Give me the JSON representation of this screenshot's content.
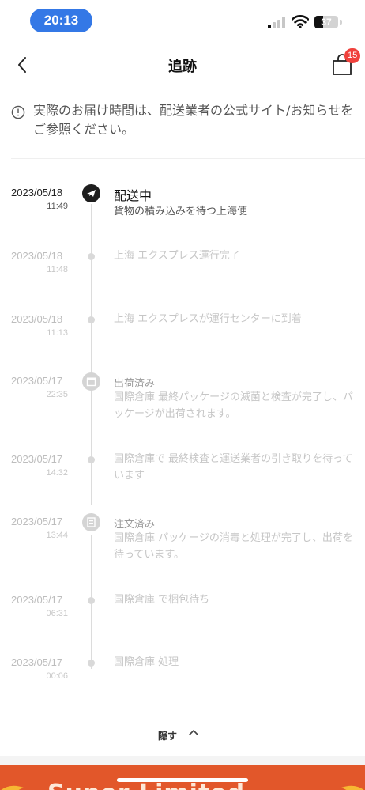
{
  "status_bar": {
    "time": "20:13",
    "battery": "37",
    "battery_level": 0.37
  },
  "header": {
    "title": "追跡",
    "bag_count": "15",
    "back_icon": "chevron-left-icon",
    "bag_icon": "shopping-bag-icon"
  },
  "notice": {
    "text": "実際のお届け時間は、配送業者の公式サイト/お知らせをご参照ください。",
    "icon": "info-icon"
  },
  "events": [
    {
      "date": "2023/05/18",
      "time": "11:49",
      "status": "配送中",
      "desc": "貨物の積み込みを待つ上海便",
      "current": true,
      "icon": "airplane-icon"
    },
    {
      "date": "2023/05/18",
      "time": "11:48",
      "status": "",
      "desc": "上海 エクスプレス運行完了"
    },
    {
      "date": "2023/05/18",
      "time": "11:13",
      "status": "",
      "desc": "上海 エクスプレスが運行センターに到着"
    },
    {
      "date": "2023/05/17",
      "time": "22:35",
      "status": "出荷済み",
      "desc": "国際倉庫 最終パッケージの滅菌と検査が完了し、パッケージが出荷されます。",
      "icon": "package-icon"
    },
    {
      "date": "2023/05/17",
      "time": "14:32",
      "status": "",
      "desc": "国際倉庫で 最終検査と運送業者の引き取りを待っています"
    },
    {
      "date": "2023/05/17",
      "time": "13:44",
      "status": "注文済み",
      "desc": "国際倉庫 パッケージの消毒と処理が完了し、出荷を待っています。",
      "icon": "order-icon"
    },
    {
      "date": "2023/05/17",
      "time": "06:31",
      "status": "",
      "desc": "国際倉庫 で梱包待ち"
    },
    {
      "date": "2023/05/17",
      "time": "00:06",
      "status": "",
      "desc": "国際倉庫 処理"
    }
  ],
  "hide_toggle": {
    "label": "隠す",
    "icon": "chevron-up-icon"
  },
  "banner": {
    "text": "Super Limited",
    "accent": "#e2572a"
  },
  "colors": {
    "accent": "#3478e6",
    "badge": "#f0413c"
  }
}
